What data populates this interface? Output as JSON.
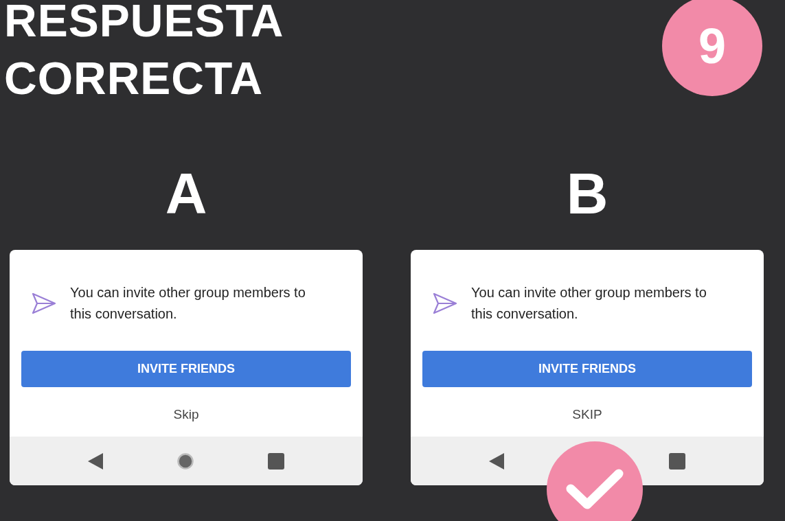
{
  "title_lines": [
    "RESPUESTA",
    "CORRECTA"
  ],
  "question_number": "9",
  "options": [
    {
      "letter": "A",
      "message": "You can invite other group members to this conversation.",
      "button": "INVITE FRIENDS",
      "skip": "Skip",
      "correct": false
    },
    {
      "letter": "B",
      "message": "You can invite other group members to this conversation.",
      "button": "INVITE FRIENDS",
      "skip": "SKIP",
      "correct": true
    }
  ]
}
